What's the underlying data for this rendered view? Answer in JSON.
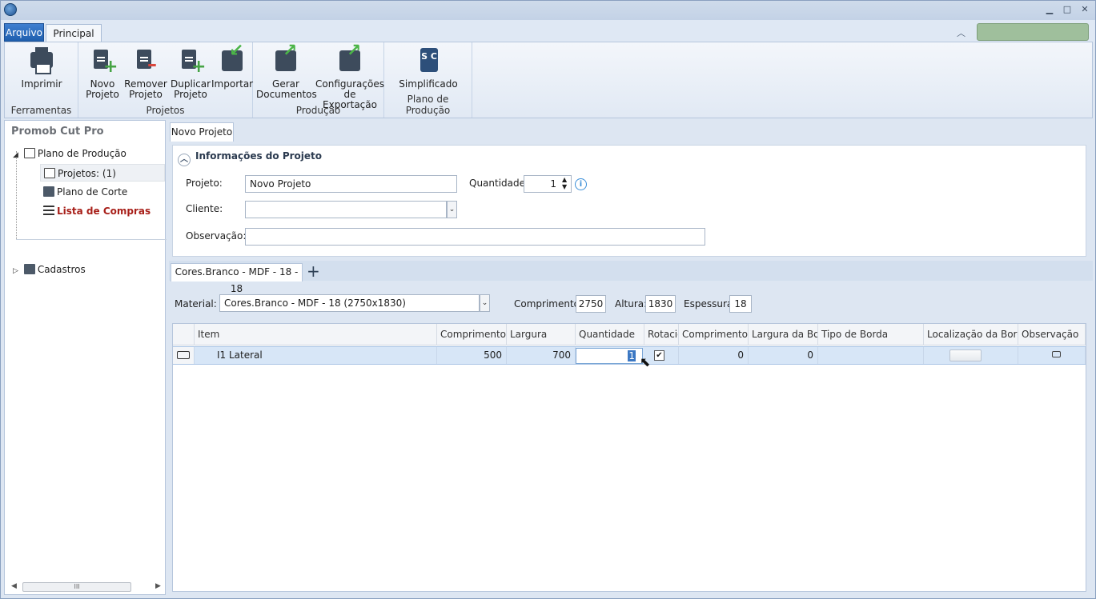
{
  "ribbon_tabs": {
    "file": "Arquivo",
    "home": "Principal"
  },
  "ribbon": {
    "groups": {
      "tools": "Ferramentas",
      "projects": "Projetos",
      "production": "Produção",
      "plan": "Plano de Produção"
    },
    "print": "Imprimir",
    "new_project": [
      "Novo",
      "Projeto"
    ],
    "remove_project": [
      "Remover",
      "Projeto"
    ],
    "duplicate_project": [
      "Duplicar",
      "Projeto"
    ],
    "import": "Importar",
    "generate_docs": [
      "Gerar",
      "Documentos"
    ],
    "export_settings": [
      "Configurações",
      "de Exportação"
    ],
    "simplified": "Simplificado",
    "sc_icon_text": "S C"
  },
  "sidebar": {
    "title": "Promob Cut Pro",
    "tree": {
      "plan": "Plano de Produção",
      "projects": "Projetos: (1)",
      "cut_plan": "Plano de Corte",
      "shopping_list": "Lista de Compras",
      "registers": "Cadastros"
    },
    "scroll_thumb": "III"
  },
  "main": {
    "doc_tab": "Novo Projeto",
    "info": {
      "header": "Informações do Projeto",
      "project_label": "Projeto:",
      "project_value": "Novo Projeto",
      "quantity_label": "Quantidade:",
      "quantity_value": "1",
      "client_label": "Cliente:",
      "client_value": "",
      "notes_label": "Observação:",
      "notes_value": ""
    },
    "material_tab": "Cores.Branco - MDF - 18 - 18",
    "material": {
      "label": "Material:",
      "value": "Cores.Branco - MDF - 18 (2750x1830)",
      "length_label": "Comprimento:",
      "length_value": "2750",
      "height_label": "Altura:",
      "height_value": "1830",
      "thickness_label": "Espessura:",
      "thickness_value": "18"
    },
    "grid": {
      "headers": [
        "Item",
        "Comprimento",
        "Largura",
        "Quantidade",
        "Rotacio",
        "Comprimento d",
        "Largura da Bor",
        "Tipo de Borda",
        "Localização da Borda",
        "Observação"
      ],
      "rows": [
        {
          "item": "I1  Lateral",
          "length": "500",
          "width": "700",
          "quantity": "1",
          "rotate": true,
          "edge_length": "0",
          "edge_width": "0",
          "edge_type": "",
          "edge_location": "",
          "notes": ""
        }
      ]
    }
  },
  "colors": {
    "accent": "#1f5fae",
    "selected_row": "#d7e6f7",
    "red_item": "#a8201a"
  }
}
